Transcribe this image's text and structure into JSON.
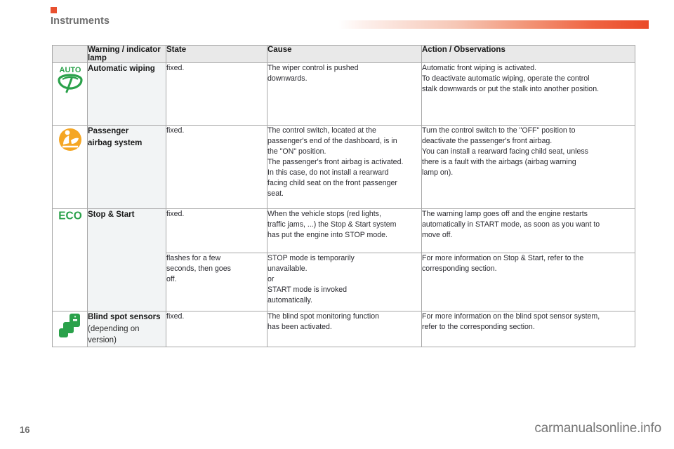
{
  "header": {
    "section_title": "Instruments",
    "marker_color": "#e8502f",
    "rule_gradient_end": "#ea4a28"
  },
  "table": {
    "columns": [
      {
        "key": "icon",
        "label": ""
      },
      {
        "key": "lamp",
        "label": "Warning / indicator lamp"
      },
      {
        "key": "state",
        "label": "State"
      },
      {
        "key": "cause",
        "label": "Cause"
      },
      {
        "key": "action",
        "label": "Action / Observations"
      }
    ],
    "rows": [
      {
        "icon_name": "auto-wiping-icon",
        "icon_color": "#2aa14a",
        "icon_label": "AUTO",
        "lamp": "Automatic wiping",
        "lamp_sub": "",
        "state": "fixed.",
        "cause_lines": [
          "The wiper control is pushed",
          "downwards."
        ],
        "action_lines": [
          "Automatic front wiping is activated.",
          "To deactivate automatic wiping, operate the control",
          "stalk downwards or put the stalk into another position."
        ]
      },
      {
        "icon_name": "passenger-airbag-icon",
        "icon_color": "#f5a623",
        "icon_label": "",
        "lamp": "Passenger",
        "lamp_sub": "airbag system",
        "state": "fixed.",
        "cause_lines": [
          "The control switch, located at the",
          "passenger's end of the dashboard, is in",
          "the \"ON\" position.",
          "The passenger's front airbag is activated.",
          "In this case, do not install a rearward",
          "facing child seat on the front passenger",
          "seat."
        ],
        "action_lines": [
          "Turn the control switch to the \"OFF\" position to",
          "deactivate the passenger's front airbag.",
          "You can install a rearward facing child seat, unless",
          "there is a fault with the airbags (airbag warning",
          "lamp on)."
        ]
      },
      {
        "icon_name": "eco-stop-start-icon",
        "icon_color": "#2aa14a",
        "icon_label": "ECO",
        "lamp": "Stop & Start",
        "lamp_sub": "",
        "state": "fixed.",
        "cause_lines": [
          "When the vehicle stops (red lights,",
          "traffic jams, ...) the Stop & Start system",
          "has put the engine into STOP mode."
        ],
        "action_lines": [
          "The warning lamp goes off and the engine restarts",
          "automatically in START mode, as soon as you want to",
          "move off."
        ]
      },
      {
        "icon_name": "",
        "icon_color": "",
        "icon_label": "",
        "lamp": "",
        "lamp_sub": "",
        "state": "flashes for a few seconds, then goes off.",
        "state_lines": [
          "flashes for a few",
          "seconds, then goes",
          "off."
        ],
        "cause_lines": [
          "STOP mode is temporarily",
          "unavailable.",
          "or",
          "START mode is invoked",
          "automatically."
        ],
        "action_lines": [
          "For more information on Stop & Start, refer to the",
          "corresponding section."
        ]
      },
      {
        "icon_name": "blind-spot-sensors-icon",
        "icon_color": "#2aa14a",
        "icon_label": "",
        "lamp": "Blind spot sensors",
        "lamp_sub": "(depending on version)",
        "state": "fixed.",
        "cause_lines": [
          "The blind spot monitoring function",
          "has been activated."
        ],
        "action_lines": [
          "For more information on the blind spot sensor system,",
          "refer to the corresponding section."
        ]
      }
    ]
  },
  "footer": {
    "page_number": "16",
    "watermark": "carmanualsonline.info"
  }
}
